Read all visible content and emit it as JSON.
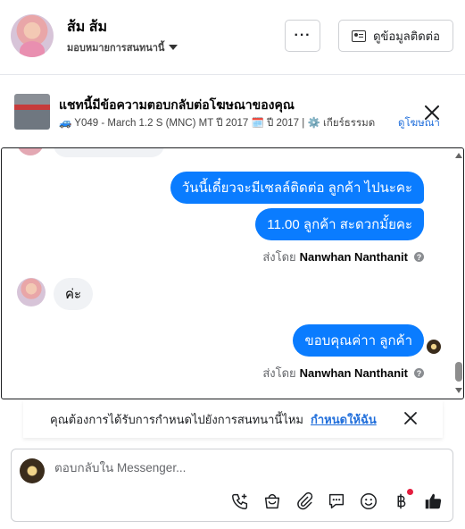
{
  "header": {
    "contact_name": "ส้ม ส้ม",
    "assign_label": "มอบหมายการสนทนานี้",
    "more_label": "···",
    "contact_info_label": "ดูข้อมูลติดต่อ"
  },
  "ad_banner": {
    "title": "แชทนี้มีข้อความตอบกลับต่อโฆษณาของคุณ",
    "subtitle": "🚙 Y049 - March 1.2 S (MNC) MT ปี 2017 🗓️ ปี 2017 | ⚙️ เกียร์ธรรมด",
    "view_ad_link": "ดูโฆษณา"
  },
  "messages": [
    {
      "direction": "out",
      "text": "วันนี้เดี๋ยวจะมีเซลล์ติดต่อ ลูกค้า ไปนะคะ"
    },
    {
      "direction": "out",
      "text": "11.00 ลูกค้า สะดวกมั้ยคะ"
    },
    {
      "direction": "in",
      "text": "ค่ะ"
    },
    {
      "direction": "out",
      "text": "ขอบคุณค่าา ลูกค้า"
    }
  ],
  "sent_by": {
    "prefix": "ส่งโดย",
    "name": "Nanwhan Nanthanit"
  },
  "assign_prompt": {
    "text": "คุณต้องการได้รับการกำหนดไปยังการสนทนานี้ไหม",
    "link": "กำหนดให้ฉัน"
  },
  "composer": {
    "placeholder": "ตอบกลับใน Messenger...",
    "tools": [
      "phone-add-icon",
      "shop-icon",
      "attachment-icon",
      "saved-reply-icon",
      "emoji-icon",
      "baht-payment-icon",
      "like-icon"
    ]
  },
  "colors": {
    "outgoing_bubble": "#0a7cff",
    "incoming_bubble": "#f0f2f5",
    "link": "#216fdb",
    "notification_dot": "#e41e3f"
  }
}
